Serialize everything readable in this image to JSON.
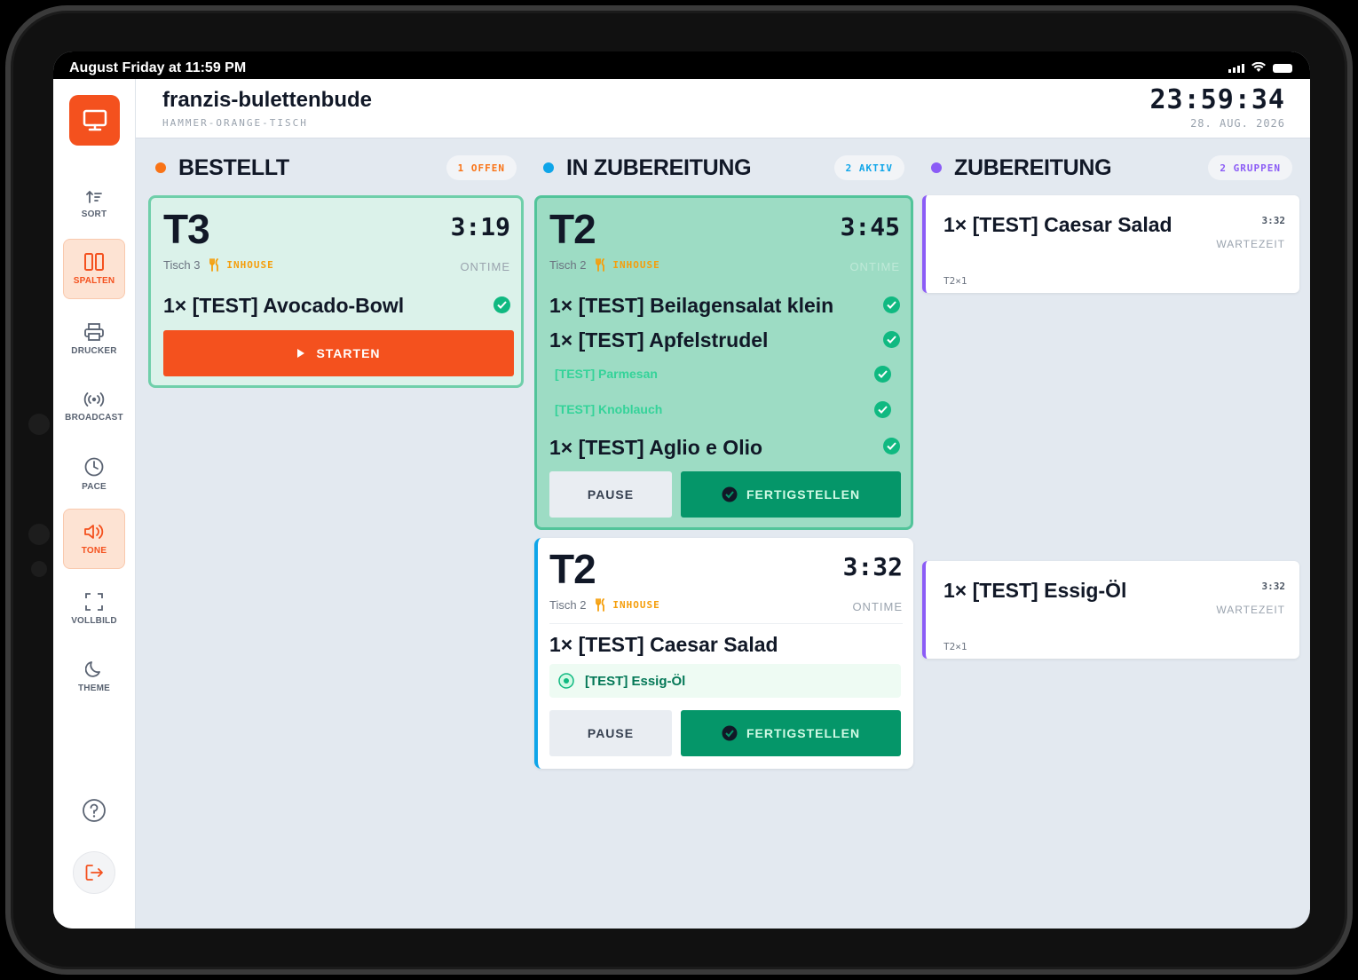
{
  "status_bar": {
    "time_text": "August Friday at 11:59 PM"
  },
  "sidebar": {
    "items": [
      {
        "label": "SORT",
        "icon": "sort-icon",
        "active": false
      },
      {
        "label": "SPALTEN",
        "icon": "columns-icon",
        "active": true
      },
      {
        "label": "DRUCKER",
        "icon": "printer-icon",
        "active": false
      },
      {
        "label": "BROADCAST",
        "icon": "broadcast-icon",
        "active": false
      },
      {
        "label": "PACE",
        "icon": "clock-icon",
        "active": false
      },
      {
        "label": "TONE",
        "icon": "speaker-icon",
        "active": true
      },
      {
        "label": "VOLLBILD",
        "icon": "fullscreen-icon",
        "active": false
      },
      {
        "label": "THEME",
        "icon": "moon-icon",
        "active": false
      }
    ]
  },
  "header": {
    "title": "franzis-bulettenbude",
    "subtitle": "HAMMER-ORANGE-TISCH",
    "clock": "23:59:34",
    "date": "28. AUG. 2026"
  },
  "columns": {
    "bestellt": {
      "title": "BESTELLT",
      "badge": "1 OFFEN",
      "color": "#f97316"
    },
    "in_zubereitung": {
      "title": "IN ZUBEREITUNG",
      "badge": "2 AKTIV",
      "color": "#0ea5e9"
    },
    "zubereitung": {
      "title": "ZUBEREITUNG",
      "badge": "2 GRUPPEN",
      "color": "#8b5cf6"
    }
  },
  "tickets": {
    "t3": {
      "id": "T3",
      "timer": "3:19",
      "table": "Tisch 3",
      "type": "INHOUSE",
      "status": "ONTIME",
      "items": [
        "1× [TEST] Avocado-Bowl"
      ],
      "action": "STARTEN"
    },
    "t2a": {
      "id": "T2",
      "timer": "3:45",
      "table": "Tisch 2",
      "type": "INHOUSE",
      "status": "ONTIME",
      "items": [
        "1× [TEST] Beilagensalat klein",
        "1× [TEST] Apfelstrudel",
        "1× [TEST] Aglio e Olio"
      ],
      "modifiers": [
        "[TEST] Parmesan",
        "[TEST] Knoblauch"
      ],
      "pause": "PAUSE",
      "finish": "FERTIGSTELLEN"
    },
    "t2b": {
      "id": "T2",
      "timer": "3:32",
      "table": "Tisch 2",
      "type": "INHOUSE",
      "status": "ONTIME",
      "items": [
        "1× [TEST] Caesar Salad"
      ],
      "modifiers": [
        "[TEST] Essig-Öl"
      ],
      "pause": "PAUSE",
      "finish": "FERTIGSTELLEN"
    }
  },
  "groups": [
    {
      "item": "1× [TEST] Caesar Salad",
      "time": "3:32",
      "label": "WARTEZEIT",
      "ref": "T2×1"
    },
    {
      "item": "1× [TEST] Essig-Öl",
      "time": "3:32",
      "label": "WARTEZEIT",
      "ref": "T2×1"
    }
  ]
}
